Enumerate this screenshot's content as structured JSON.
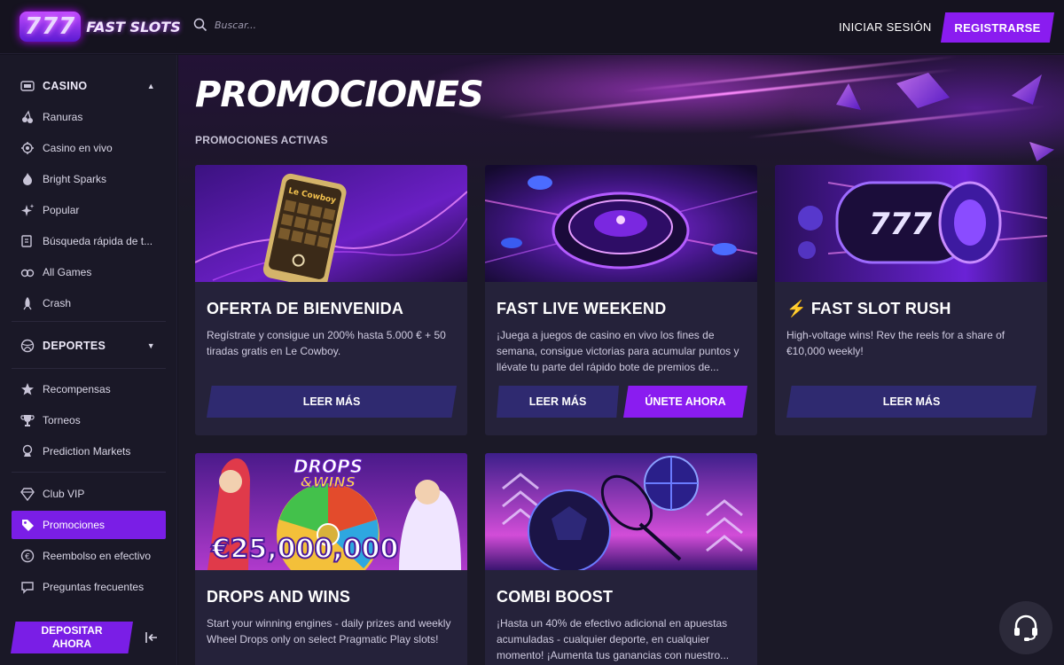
{
  "header": {
    "logo_text": "777",
    "brand": "FAST SLOTS",
    "search_placeholder": "Buscar...",
    "login_label": "INICIAR SESIÓN",
    "register_label": "REGISTRARSE"
  },
  "sidebar": {
    "casino_label": "CASINO",
    "casino_items": [
      {
        "label": "Ranuras",
        "icon": "cherries-icon"
      },
      {
        "label": "Casino en vivo",
        "icon": "live-casino-icon"
      },
      {
        "label": "Bright Sparks",
        "icon": "flame-icon"
      },
      {
        "label": "Popular",
        "icon": "sparkles-icon"
      },
      {
        "label": "Búsqueda rápida de t...",
        "icon": "quick-search-icon"
      },
      {
        "label": "All Games",
        "icon": "joystick-icon"
      },
      {
        "label": "Crash",
        "icon": "rocket-icon"
      }
    ],
    "sports_label": "DEPORTES",
    "extra_items": [
      {
        "label": "Recompensas",
        "icon": "star-icon"
      },
      {
        "label": "Torneos",
        "icon": "trophy-icon"
      },
      {
        "label": "Prediction Markets",
        "icon": "prediction-icon"
      }
    ],
    "bottom_items": [
      {
        "label": "Club VIP",
        "icon": "diamond-icon"
      },
      {
        "label": "Promociones",
        "icon": "promo-tag-icon"
      },
      {
        "label": "Reembolso en efectivo",
        "icon": "cashback-icon"
      },
      {
        "label": "Preguntas frecuentes",
        "icon": "faq-icon"
      }
    ],
    "deposit_label_line1": "DEPOSITAR",
    "deposit_label_line2": "AHORA"
  },
  "main": {
    "title": "PROMOCIONES",
    "section_label": "PROMOCIONES ACTIVAS",
    "cards": [
      {
        "title": "OFERTA DE BIENVENIDA",
        "description": "Regístrate y consigue un 200% hasta 5.000 € + 50 tiradas gratis en Le Cowboy.",
        "read_more": "LEER MÁS",
        "image_text": "Le Cowboy"
      },
      {
        "title": "FAST LIVE WEEKEND",
        "description": "¡Juega a juegos de casino en vivo los fines de semana, consigue victorias para acumular puntos y llévate tu parte del rápido bote de premios de...",
        "read_more": "LEER MÁS",
        "join": "ÚNETE AHORA"
      },
      {
        "title_icon": "⚡",
        "title": "FAST SLOT RUSH",
        "description": "High-voltage wins! Rev the reels for a share of €10,000 weekly!",
        "read_more": "LEER MÁS",
        "image_text": "777"
      },
      {
        "title": "DROPS AND WINS",
        "description": "Start your winning engines - daily prizes and weekly Wheel Drops only on select Pragmatic Play slots!",
        "image_text_top": "DROPS",
        "image_text_mid": "&WINS",
        "image_amount": "€25,000,000"
      },
      {
        "title": "COMBI BOOST",
        "description": "¡Hasta un 40% de efectivo adicional en apuestas acumuladas - cualquier deporte, en cualquier momento! ¡Aumenta tus ganancias con nuestro..."
      }
    ]
  },
  "colors": {
    "accent": "#8a1cf0",
    "sidebar_bg": "#1a1827",
    "card_bg": "#25223a",
    "button_dark": "#2f2a70"
  }
}
